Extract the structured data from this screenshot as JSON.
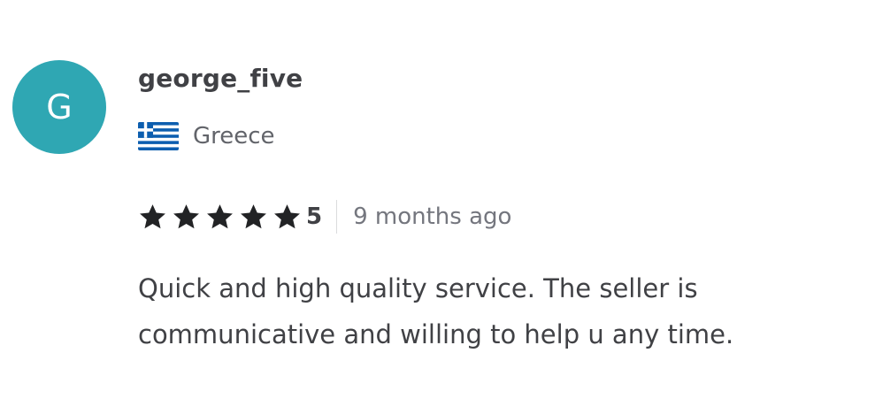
{
  "review": {
    "avatar_letter": "G",
    "avatar_color": "#2fa7b3",
    "username": "george_five",
    "country": {
      "flag_icon": "greece-flag-icon",
      "name": "Greece"
    },
    "rating": {
      "stars": 5,
      "value": "5",
      "star_color": "#222325"
    },
    "time_ago": "9 months ago",
    "text": "Quick and high quality service. The seller is communicative and willing to help u any time."
  }
}
